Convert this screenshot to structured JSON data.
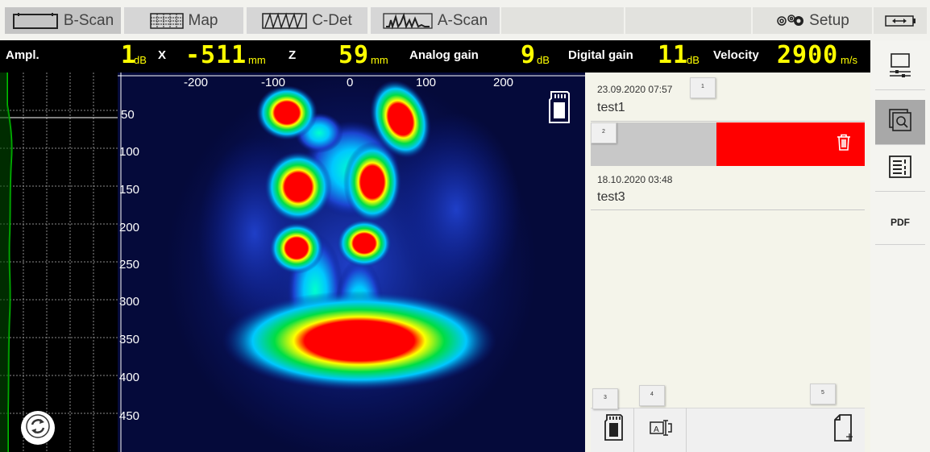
{
  "tabs": [
    {
      "label": "B-Scan",
      "icon": "bscan-icon",
      "active": true
    },
    {
      "label": "Map",
      "icon": "grid-map-icon",
      "active": false
    },
    {
      "label": "C-Det",
      "icon": "cdet-icon",
      "active": false
    },
    {
      "label": "A-Scan",
      "icon": "ascan-waveform-icon",
      "active": false
    },
    {
      "label": "Setup",
      "icon": "gears-icon",
      "active": false
    }
  ],
  "status": {
    "ampl_label": "Ampl.",
    "ampl_value": "1",
    "ampl_unit": "dB",
    "x_label": "X",
    "x_value": "-511",
    "x_unit": "mm",
    "z_label": "Z",
    "z_value": "59",
    "z_unit": "mm",
    "analog_label": "Analog gain",
    "analog_value": "9",
    "analog_unit": "dB",
    "digital_label": "Digital gain",
    "digital_value": "11",
    "digital_unit": "dB",
    "velocity_label": "Velocity",
    "velocity_value": "2900",
    "velocity_unit": "m/s"
  },
  "bscan": {
    "x_ticks": [
      "-200",
      "-100",
      "0",
      "100",
      "200"
    ],
    "y_ticks": [
      "50",
      "100",
      "150",
      "200",
      "250",
      "300",
      "350",
      "400",
      "450"
    ]
  },
  "records": [
    {
      "date": "23.09.2020 07:57",
      "name": "test1",
      "badge": "1"
    },
    {
      "date": "",
      "name": "",
      "badge": "2"
    },
    {
      "date": "18.10.2020 03:48",
      "name": "test3",
      "badge": ""
    }
  ],
  "bottom_badges": [
    "3",
    "4",
    "5"
  ],
  "right_tools": {
    "pdf_label": "PDF"
  },
  "colors": {
    "status_value": "#ffff00",
    "delete_bg": "#ff0000",
    "ascan_trace": "#00c000"
  }
}
